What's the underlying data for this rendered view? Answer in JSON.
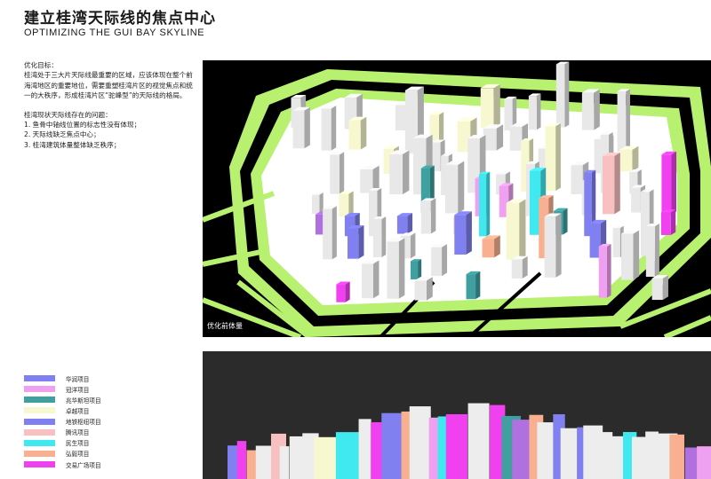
{
  "header": {
    "title_cn": "建立桂湾天际线的焦点中心",
    "title_en": "OPTIMIZING THE GUI BAY SKYLINE"
  },
  "text": {
    "goal_heading": "优化目标：",
    "goal_body": "桂湾处于三大片天际线最重要的区域，应该体现在整个前海湾地区的重要地位，需要重塑桂湾片区的视觉焦点和统一的大秩序，形成桂湾片区“驼峰型”的天际线的格局。",
    "issues_heading": "桂湾现状天际线存在的问题：",
    "issues": [
      "1.  鱼骨中轴线位置的标志性没有体现；",
      "2.  天际线缺乏焦点中心；",
      "3.  桂湾建筑体量整体缺乏秩序；"
    ]
  },
  "figure_top": {
    "caption": "优化前体量"
  },
  "legend": [
    {
      "label": "华润项目",
      "color": "#8080f0"
    },
    {
      "label": "冠洋项目",
      "color": "#f0a0f0"
    },
    {
      "label": "兆华斯坦项目",
      "color": "#40a0a0"
    },
    {
      "label": "卓越项目",
      "color": "#f8f8d0"
    },
    {
      "label": "地铁枢纽项目",
      "color": "#8080f0"
    },
    {
      "label": "腾讯项目",
      "color": "#f8c0c0"
    },
    {
      "label": "民生项目",
      "color": "#40e8f0"
    },
    {
      "label": "弘毅项目",
      "color": "#f8b090"
    },
    {
      "label": "交易广场项目",
      "color": "#f040f0"
    }
  ]
}
